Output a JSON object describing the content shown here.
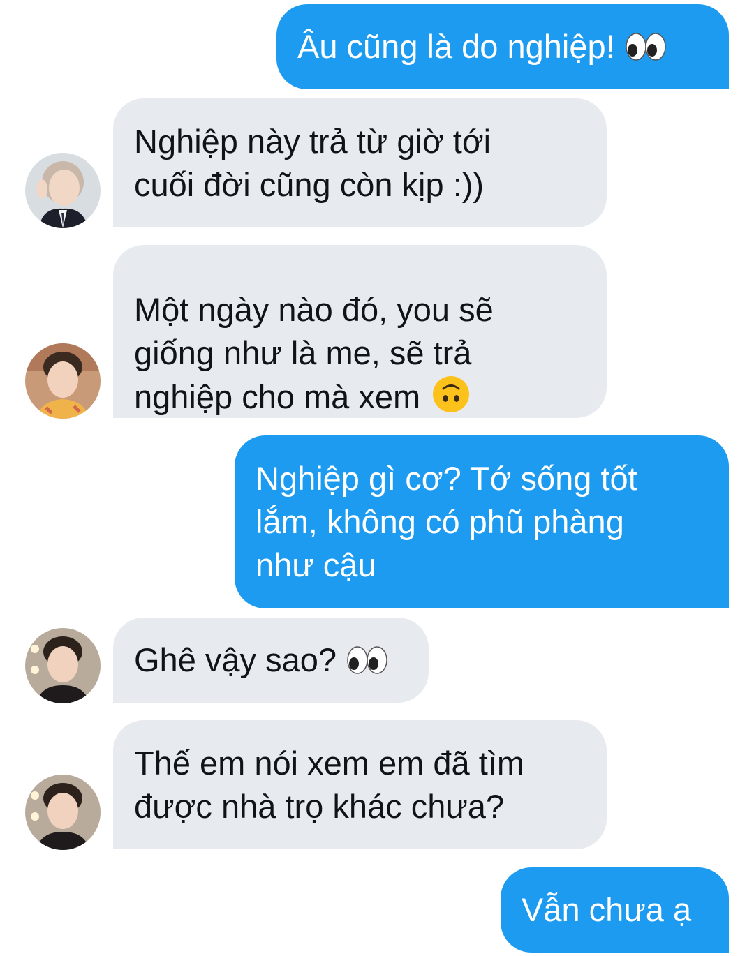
{
  "messages": [
    {
      "id": "m1",
      "side": "out",
      "text": "Âu cũng là do nghiệp!",
      "emoji": "eyes-emoji"
    },
    {
      "id": "m2",
      "side": "in",
      "text": "Nghiệp này trả từ giờ tới\ncuối đời cũng còn kịp :))",
      "avatar": "avatar-1"
    },
    {
      "id": "m3",
      "side": "in",
      "text": "Một ngày nào đó, you sẽ\ngiống như là me, sẽ trả\nnghiệp cho mà xem",
      "emoji": "upside-down-face-emoji",
      "avatar": "avatar-2"
    },
    {
      "id": "m4",
      "side": "out",
      "text": "Nghiệp gì cơ? Tớ sống tốt\nlắm, không có phũ phàng\nnhư cậu"
    },
    {
      "id": "m5",
      "side": "in",
      "text": "Ghê vậy sao?",
      "emoji": "eyes-emoji",
      "avatar": "avatar-3"
    },
    {
      "id": "m6",
      "side": "in",
      "text": "Thế em nói xem em đã tìm\nđược nhà trọ khác chưa?",
      "avatar": "avatar-4"
    },
    {
      "id": "m7",
      "side": "out",
      "text": "Vẫn chưa ạ"
    }
  ],
  "colors": {
    "outgoing_bubble": "#1d9bf0",
    "incoming_bubble": "#e7ebef",
    "incoming_text": "#0f1419",
    "outgoing_text": "#ffffff"
  }
}
